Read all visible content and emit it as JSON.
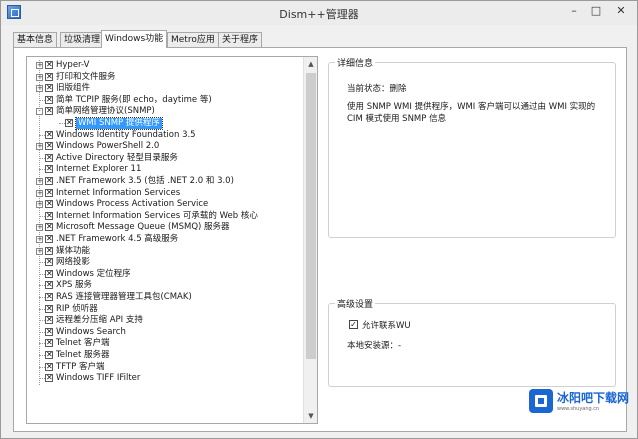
{
  "window": {
    "title": "Dism++管理器"
  },
  "tabs": [
    "基本信息",
    "垃圾清理",
    "Windows功能",
    "Metro应用",
    "关于程序"
  ],
  "active_tab": "Windows功能",
  "features": [
    {
      "label": "Hyper-V",
      "expander": "+",
      "checked": true
    },
    {
      "label": "打印和文件服务",
      "expander": "+",
      "checked": true
    },
    {
      "label": "旧版组件",
      "expander": "+",
      "checked": true
    },
    {
      "label": "简单 TCPIP 服务(即 echo，daytime 等)",
      "checked": true
    },
    {
      "label": "简单网络管理协议(SNMP)",
      "expander": "-",
      "checked": true
    },
    {
      "label": "WMI SNMP 提供程序",
      "checked": true,
      "child": true,
      "selected": true
    },
    {
      "label": "Windows Identity Foundation 3.5",
      "checked": true
    },
    {
      "label": "Windows PowerShell 2.0",
      "expander": "+",
      "checked": true
    },
    {
      "label": "Active Directory 轻型目录服务",
      "checked": true
    },
    {
      "label": "Internet Explorer 11",
      "checked": true
    },
    {
      "label": ".NET Framework 3.5 (包括 .NET 2.0 和 3.0)",
      "expander": "+",
      "checked": true
    },
    {
      "label": "Internet Information Services",
      "expander": "+",
      "checked": true
    },
    {
      "label": "Windows Process Activation Service",
      "expander": "+",
      "checked": true
    },
    {
      "label": "Internet Information Services 可承载的 Web 核心",
      "checked": true
    },
    {
      "label": "Microsoft Message Queue (MSMQ) 服务器",
      "expander": "+",
      "checked": true
    },
    {
      "label": ".NET Framework 4.5 高级服务",
      "expander": "+",
      "checked": true
    },
    {
      "label": "媒体功能",
      "expander": "+",
      "checked": true
    },
    {
      "label": "网络投影",
      "checked": true
    },
    {
      "label": "Windows 定位程序",
      "checked": true
    },
    {
      "label": "XPS 服务",
      "checked": true
    },
    {
      "label": "RAS 连接管理器管理工具包(CMAK)",
      "checked": true
    },
    {
      "label": "RIP 侦听器",
      "checked": true
    },
    {
      "label": "远程差分压缩 API 支持",
      "checked": true
    },
    {
      "label": "Windows Search",
      "checked": true
    },
    {
      "label": "Telnet 客户端",
      "checked": true
    },
    {
      "label": "Telnet 服务器",
      "checked": true
    },
    {
      "label": "TFTP 客户端",
      "checked": true
    },
    {
      "label": "Windows TIFF IFilter",
      "checked": true
    }
  ],
  "details": {
    "title": "详细信息",
    "status_label": "当前状态：",
    "status_value": "删除",
    "description": "使用 SNMP WMI 提供程序，WMI 客户端可以通过由 WMI 实现的 CIM 模式使用 SNMP 信息"
  },
  "advanced": {
    "title": "高级设置",
    "checkbox_label": "允许联系WU",
    "checkbox_checked": true,
    "local_source_label": "本地安装源：",
    "local_source_value": "-"
  },
  "watermark": {
    "text": "冰阳吧下载网",
    "sub": "www.shuyang.cn"
  }
}
